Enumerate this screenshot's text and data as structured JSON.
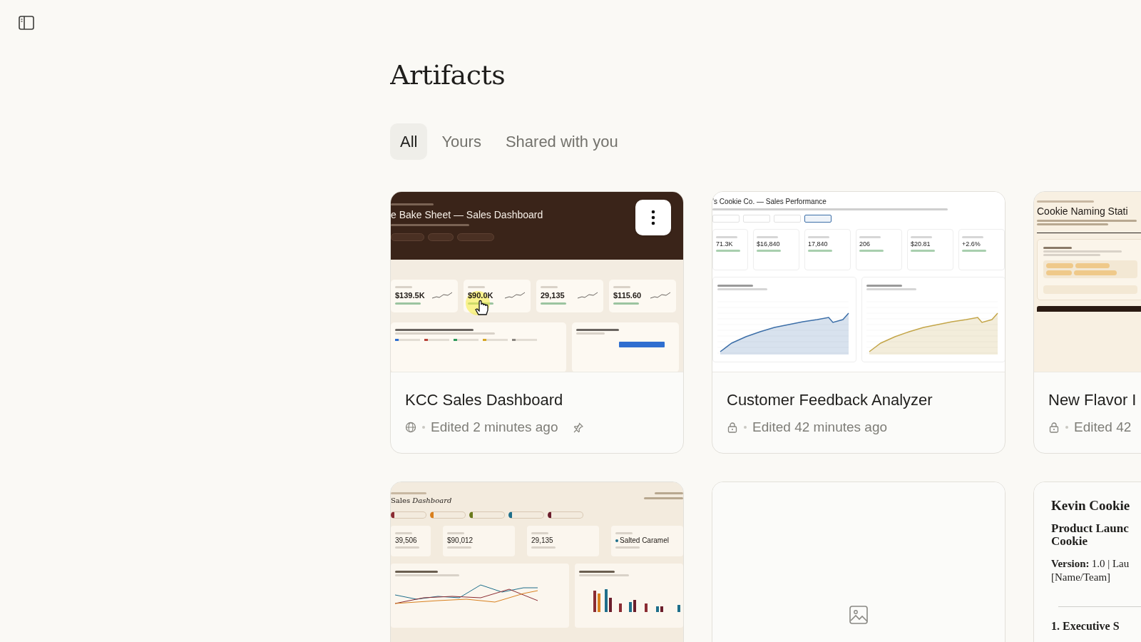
{
  "title": "Artifacts",
  "tabs": [
    {
      "label": "All",
      "selected": true
    },
    {
      "label": "Yours",
      "selected": false
    },
    {
      "label": "Shared with you",
      "selected": false
    }
  ],
  "artifacts": [
    {
      "title": "KCC Sales Dashboard",
      "shared": true,
      "edited": "Edited 2 minutes ago",
      "pinned": true,
      "menu_visible": true,
      "preview": {
        "kind": "dark-dashboard",
        "heading": "e Bake Sheet — Sales Dashboard",
        "kpis": [
          "$139.5K",
          "$90.0K",
          "29,135",
          "$115.60"
        ]
      }
    },
    {
      "title": "Customer Feedback Analyzer",
      "shared": false,
      "edited": "Edited 42 minutes ago",
      "pinned": false,
      "menu_visible": false,
      "preview": {
        "kind": "light-dashboard",
        "heading": "'s Cookie Co. — Sales Performance",
        "ranges": [
          {
            "selected": false
          },
          {
            "selected": false
          },
          {
            "selected": false
          },
          {
            "selected": true
          }
        ],
        "kpis": [
          "71.3K",
          "$16,840",
          "17,840",
          "206",
          "$20.81",
          "+2.6%"
        ],
        "charts": [
          {
            "color": "#3d6fa8"
          },
          {
            "color": "#c4a64a"
          }
        ]
      }
    },
    {
      "title": "New Flavor I",
      "shared": false,
      "edited": "Edited 42",
      "pinned": false,
      "menu_visible": false,
      "preview": {
        "kind": "form",
        "heading": "Cookie Naming Stati"
      }
    },
    {
      "preview": {
        "kind": "cream-dashboard",
        "heading": "Sales *Dashboard*",
        "kpis": [
          {
            "value": "39,506"
          },
          {
            "value": "$90,012"
          },
          {
            "value": "29,135"
          },
          {
            "value": "Salted Caramel",
            "color": "#1e6f8b"
          }
        ]
      }
    },
    {
      "preview": {
        "kind": "empty"
      }
    },
    {
      "preview": {
        "kind": "document",
        "heading": "Kevin Cookie",
        "subheading": [
          "Product Launc",
          "Cookie"
        ],
        "meta_label": "Version:",
        "meta_value": "1.0 | Lau",
        "meta_line": "[Name/Team]",
        "section": "1. Executive S"
      }
    }
  ]
}
